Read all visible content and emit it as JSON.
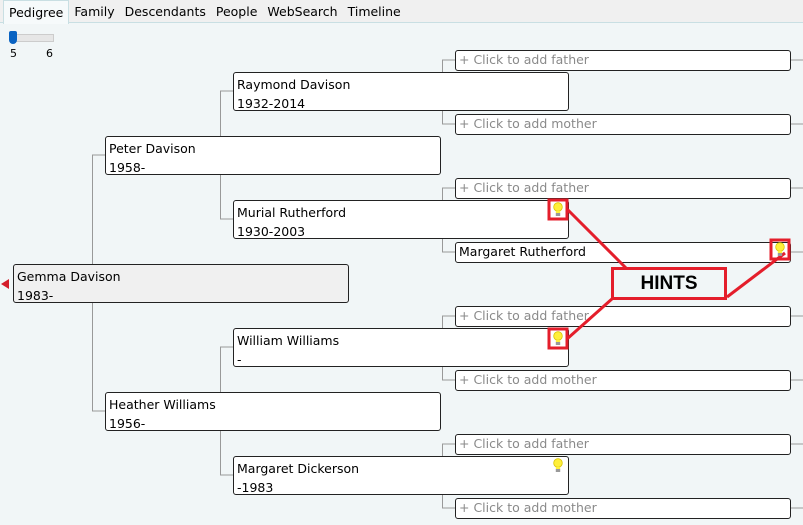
{
  "tabs": [
    {
      "label": "Pedigree",
      "active": true
    },
    {
      "label": "Family"
    },
    {
      "label": "Descendants"
    },
    {
      "label": "People"
    },
    {
      "label": "WebSearch"
    },
    {
      "label": "Timeline"
    }
  ],
  "generations_slider": {
    "value": 5,
    "min_label": "5",
    "max_label": "6"
  },
  "people": {
    "root": {
      "name": "Gemma Davison",
      "dates": "1983-"
    },
    "father": {
      "name": "Peter Davison",
      "dates": "1958-"
    },
    "mother": {
      "name": "Heather Williams",
      "dates": "1956-"
    },
    "pat_grandfather": {
      "name": "Raymond Davison",
      "dates": "1932-2014"
    },
    "pat_grandmother": {
      "name": "Murial Rutherford",
      "dates": "1930-2003"
    },
    "mat_grandfather": {
      "name": "William Williams",
      "dates": "-"
    },
    "mat_grandmother": {
      "name": "Margaret Dickerson",
      "dates": "-1983"
    },
    "gg_murial_mother": {
      "name": "Margaret Rutherford"
    }
  },
  "placeholders": {
    "add_father": "+ Click to add father",
    "add_mother": "+ Click to add mother"
  },
  "annotation": {
    "label": "HINTS",
    "color": "#e41e2b"
  },
  "icons": {
    "hint": "lightbulb-icon",
    "nav": "triangle-left-icon"
  }
}
